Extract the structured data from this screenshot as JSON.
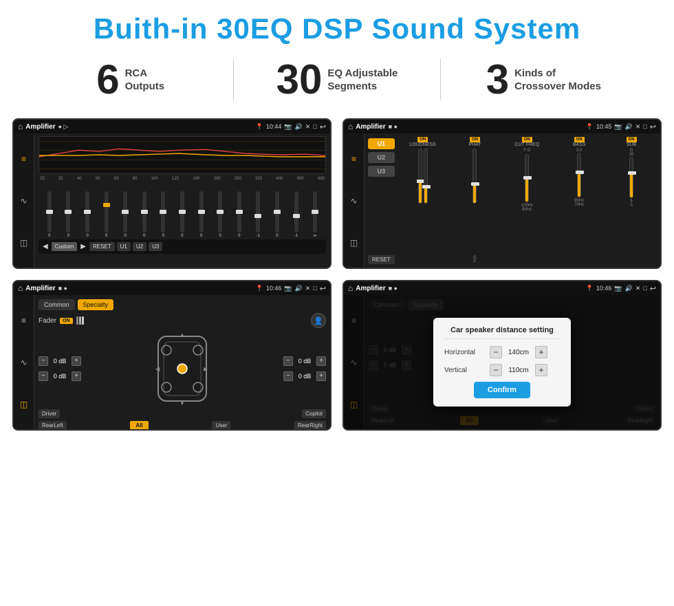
{
  "header": {
    "title": "Buith-in 30EQ DSP Sound System"
  },
  "stats": [
    {
      "number": "6",
      "label": "RCA\nOutputs"
    },
    {
      "number": "30",
      "label": "EQ Adjustable\nSegments"
    },
    {
      "number": "3",
      "label": "Kinds of\nCrossover Modes"
    }
  ],
  "screen1": {
    "app": "Amplifier",
    "time": "10:44",
    "freq_labels": [
      "25",
      "32",
      "40",
      "50",
      "63",
      "80",
      "100",
      "125",
      "160",
      "200",
      "250",
      "320",
      "400",
      "500",
      "630"
    ],
    "slider_values": [
      "0",
      "0",
      "0",
      "5",
      "0",
      "0",
      "0",
      "0",
      "0",
      "0",
      "0",
      "-1",
      "0",
      "-1"
    ],
    "buttons": [
      "Custom",
      "RESET",
      "U1",
      "U2",
      "U3"
    ]
  },
  "screen2": {
    "app": "Amplifier",
    "time": "10:45",
    "u_buttons": [
      "U1",
      "U2",
      "U3"
    ],
    "cols": [
      "LOUDNESS",
      "PHAT",
      "CUT FREQ",
      "BASS",
      "SUB"
    ],
    "on_labels": [
      "ON",
      "ON",
      "ON",
      "ON",
      "ON"
    ],
    "reset_label": "RESET"
  },
  "screen3": {
    "app": "Amplifier",
    "time": "10:46",
    "tabs": [
      "Common",
      "Specialty"
    ],
    "fader_label": "Fader",
    "fader_on": "ON",
    "db_values": [
      "0 dB",
      "0 dB",
      "0 dB",
      "0 dB"
    ],
    "bottom_labels": [
      "Driver",
      "Copilot",
      "RearLeft",
      "RearRight"
    ],
    "all_btn": "All",
    "user_btn": "User"
  },
  "screen4": {
    "app": "Amplifier",
    "time": "10:46",
    "tabs": [
      "Common",
      "Specialty"
    ],
    "modal": {
      "title": "Car speaker distance setting",
      "horizontal_label": "Horizontal",
      "horizontal_value": "140cm",
      "vertical_label": "Vertical",
      "vertical_value": "110cm",
      "confirm_btn": "Confirm"
    },
    "bottom_labels": [
      "Driver",
      "Copilot",
      "RearLeft",
      "RearRight"
    ],
    "db_values": [
      "0 dB",
      "0 dB"
    ]
  },
  "icons": {
    "home": "⌂",
    "back": "↩",
    "location": "📍",
    "camera": "📷",
    "volume": "🔊",
    "close": "✕",
    "window": "□",
    "eq_icon": "⣿",
    "wave_icon": "∿",
    "speaker_icon": "▣",
    "profile_icon": "👤",
    "car_icon": "🚗"
  }
}
